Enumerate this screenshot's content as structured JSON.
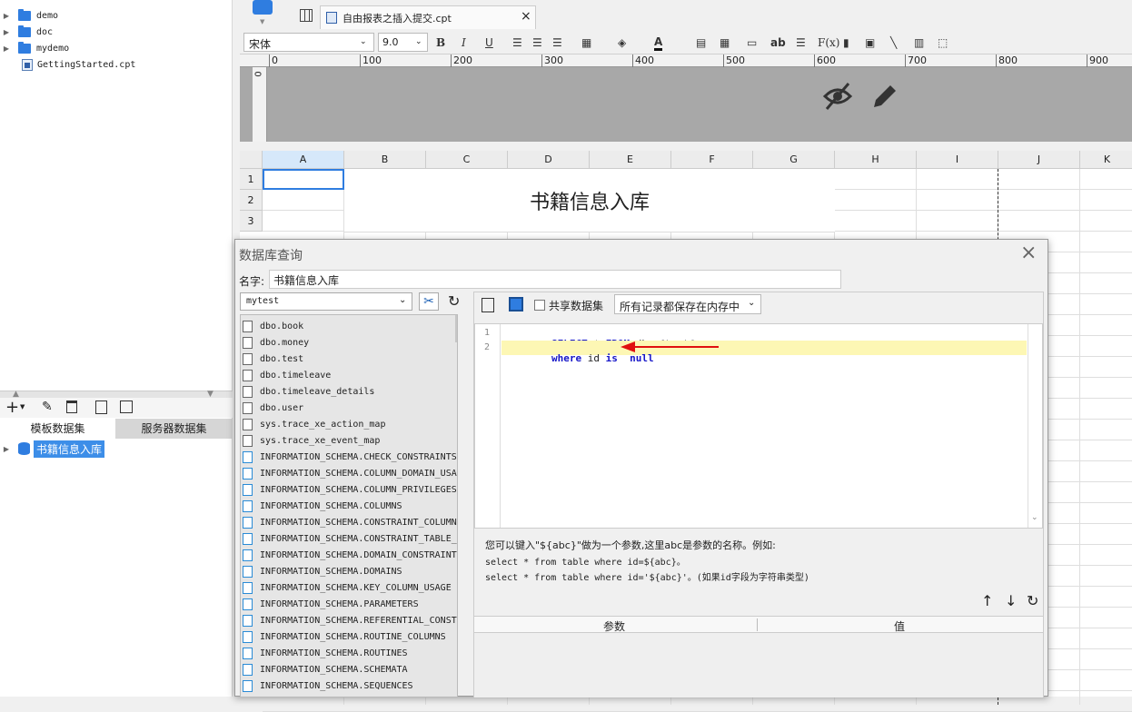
{
  "left_tree": [
    {
      "label": "demo",
      "kind": "folder"
    },
    {
      "label": "doc",
      "kind": "folder"
    },
    {
      "label": "mydemo",
      "kind": "folder"
    },
    {
      "label": "GettingStarted.cpt",
      "kind": "file"
    }
  ],
  "dataset_tabs": [
    "模板数据集",
    "服务器数据集"
  ],
  "dataset_item": "书籍信息入库",
  "editor_tab": "自由报表之插入提交.cpt",
  "font": {
    "family": "宋体",
    "size": "9.0"
  },
  "ruler_ticks": [
    "0",
    "100",
    "200",
    "300",
    "400",
    "500",
    "600",
    "700",
    "800",
    "900"
  ],
  "columns": [
    "A",
    "B",
    "C",
    "D",
    "E",
    "F",
    "G",
    "H",
    "I",
    "J",
    "K"
  ],
  "rows": [
    "1",
    "2",
    "3"
  ],
  "report_title": "书籍信息入库",
  "dialog": {
    "title": "数据库查询",
    "name_label": "名字:",
    "name_value": "书籍信息入库",
    "connection": "mytest",
    "share_label": "共享数据集",
    "memory_option": "所有记录都保存在内存中",
    "tables": [
      "dbo.book",
      "dbo.money",
      "dbo.test",
      "dbo.timeleave",
      "dbo.timeleave_details",
      "dbo.user",
      "sys.trace_xe_action_map",
      "sys.trace_xe_event_map",
      "INFORMATION_SCHEMA.CHECK_CONSTRAINTS",
      "INFORMATION_SCHEMA.COLUMN_DOMAIN_USAG",
      "INFORMATION_SCHEMA.COLUMN_PRIVILEGES",
      "INFORMATION_SCHEMA.COLUMNS",
      "INFORMATION_SCHEMA.CONSTRAINT_COLUMN",
      "INFORMATION_SCHEMA.CONSTRAINT_TABLE_",
      "INFORMATION_SCHEMA.DOMAIN_CONSTRAINT",
      "INFORMATION_SCHEMA.DOMAINS",
      "INFORMATION_SCHEMA.KEY_COLUMN_USAGE",
      "INFORMATION_SCHEMA.PARAMETERS",
      "INFORMATION_SCHEMA.REFERENTIAL_CONST",
      "INFORMATION_SCHEMA.ROUTINE_COLUMNS",
      "INFORMATION_SCHEMA.ROUTINES",
      "INFORMATION_SCHEMA.SCHEMATA",
      "INFORMATION_SCHEMA.SEQUENCES"
    ],
    "sql_line_numbers": [
      "1",
      "2"
    ],
    "sql": {
      "line1": {
        "kw1": "SELECT",
        "star": "*",
        "kw2": "FROM",
        "schema": "dbo.",
        "table": "[book]"
      },
      "line2": {
        "kw1": "where",
        "col": "id",
        "kw2": "is",
        "kw3": "null"
      }
    },
    "hint": {
      "line1": "您可以键入\"${abc}\"做为一个参数,这里abc是参数的名称。例如:",
      "line2": "select * from table where id=${abc}。",
      "line3": "select * from table where id='${abc}'。(如果id字段为字符串类型)"
    },
    "param_headers": [
      "参数",
      "值"
    ]
  }
}
